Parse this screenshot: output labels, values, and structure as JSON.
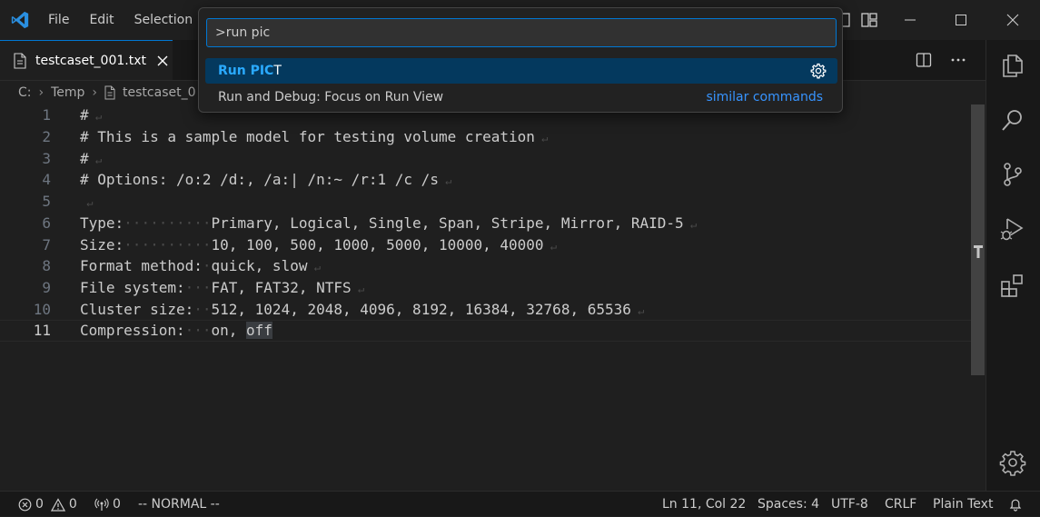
{
  "menu": [
    "File",
    "Edit",
    "Selection"
  ],
  "tab": {
    "label": "testcaset_001.txt"
  },
  "breadcrumb": {
    "drive": "C:",
    "folder": "Temp",
    "file": "testcaset_0"
  },
  "code": {
    "lines": [
      {
        "n": "1",
        "text": "#"
      },
      {
        "n": "2",
        "text": "# This is a sample model for testing volume creation"
      },
      {
        "n": "3",
        "text": "#"
      },
      {
        "n": "4",
        "text": "# Options: /o:2 /d:, /a:| /n:~ /r:1 /c /s"
      },
      {
        "n": "5",
        "text": ""
      },
      {
        "n": "6",
        "key": "Type:",
        "pad": 10,
        "value": "Primary, Logical, Single, Span, Stripe, Mirror, RAID-5"
      },
      {
        "n": "7",
        "key": "Size:",
        "pad": 10,
        "value": "10, 100, 500, 1000, 5000, 10000, 40000"
      },
      {
        "n": "8",
        "key": "Format method:",
        "pad": 1,
        "value": "quick, slow"
      },
      {
        "n": "9",
        "key": "File system:",
        "pad": 3,
        "value": "FAT, FAT32, NTFS"
      },
      {
        "n": "10",
        "key": "Cluster size:",
        "pad": 2,
        "value": "512, 1024, 2048, 4096, 8192, 16384, 32768, 65536"
      },
      {
        "n": "11",
        "key": "Compression:",
        "pad": 3,
        "value": "on, ",
        "highlight": "off"
      }
    ]
  },
  "palette": {
    "query": ">run pic",
    "items": [
      {
        "match": "Run PIC",
        "rest": "T",
        "selected": true
      },
      {
        "label": "Run and Debug: Focus on Run View",
        "secondary": "similar commands"
      }
    ]
  },
  "status": {
    "errors": "0",
    "warnings": "0",
    "ports": "0",
    "mode": "-- NORMAL --",
    "position": "Ln 11, Col 22",
    "spaces": "Spaces: 4",
    "encoding": "UTF-8",
    "eol": "CRLF",
    "language": "Plain Text"
  },
  "colors": {
    "accent": "#0078d4",
    "selection": "#04395e",
    "match": "#2aaaff",
    "link": "#3794ff"
  }
}
